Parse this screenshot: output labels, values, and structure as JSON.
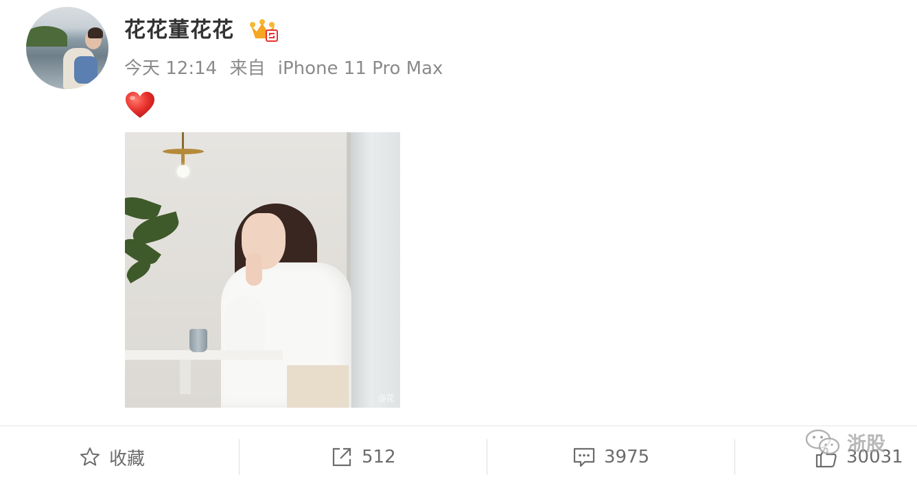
{
  "post": {
    "username": "花花董花花",
    "meta": {
      "time": "今天 12:14",
      "source_prefix": "来自",
      "device": "iPhone 11 Pro Max"
    },
    "content_emoji": "heart",
    "image_watermark": "@花",
    "badge_icon": "crown-vip-icon"
  },
  "actions": {
    "favorite": {
      "label": "收藏",
      "icon": "star-icon"
    },
    "repost": {
      "count": "512",
      "icon": "share-icon"
    },
    "comment": {
      "count": "3975",
      "icon": "comment-icon"
    },
    "like": {
      "count": "30031",
      "icon": "thumbs-up-icon"
    }
  },
  "overlay_watermark": {
    "text": "浙股",
    "icon": "wechat-icon"
  },
  "colors": {
    "accent_gold": "#f5a623",
    "heart_red": "#e8322d",
    "meta_gray": "#8a8a8a",
    "username": "#333333"
  }
}
